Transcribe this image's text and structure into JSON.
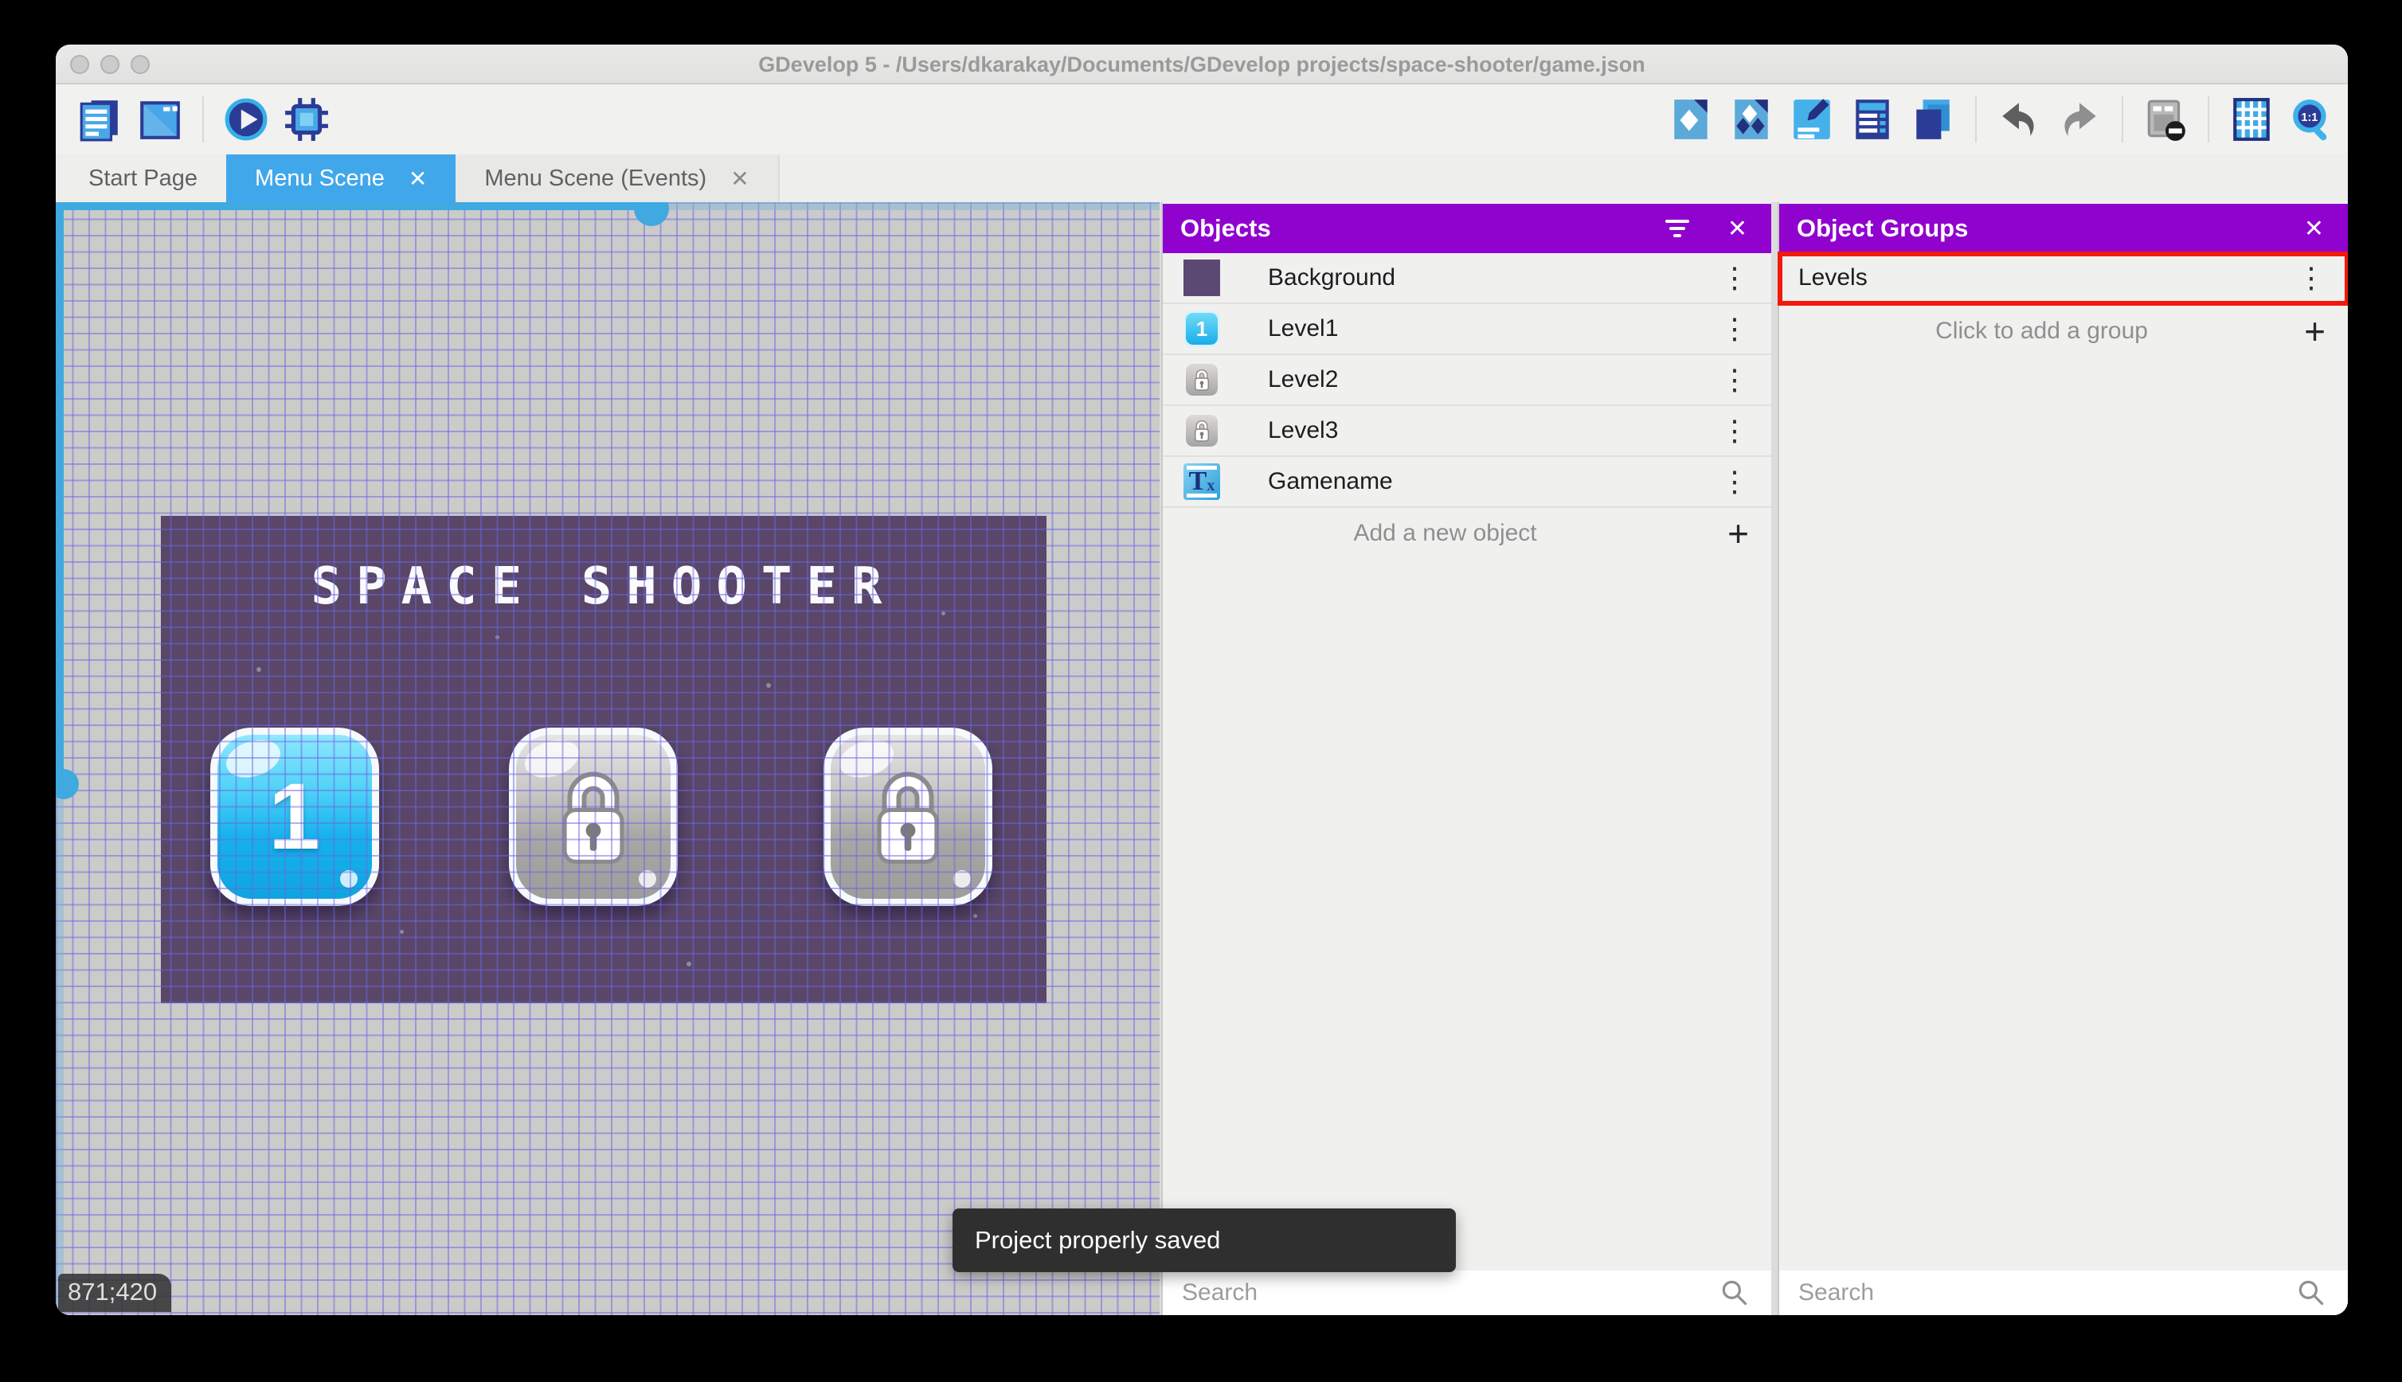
{
  "window": {
    "title": "GDevelop 5 - /Users/dkarakay/Documents/GDevelop projects/space-shooter/game.json"
  },
  "toolbar": {
    "left_icons": [
      "project-manager",
      "scene-window",
      "play-preview",
      "debug"
    ],
    "right_icons": [
      "objects-panel",
      "object-groups-panel",
      "properties",
      "instances-list",
      "layers",
      "undo",
      "redo",
      "render-mask",
      "grid",
      "zoom-1-1"
    ]
  },
  "tabs": [
    {
      "label": "Start Page",
      "active": false,
      "closable": false
    },
    {
      "label": "Menu Scene",
      "active": true,
      "closable": true,
      "close_glyph": "✕"
    },
    {
      "label": "Menu Scene (Events)",
      "active": false,
      "closable": true,
      "close_glyph": "✕"
    }
  ],
  "canvas": {
    "coordinates": "871;420",
    "scene": {
      "title": "SPACE SHOOTER",
      "buttons": [
        {
          "label": "1",
          "state": "unlocked"
        },
        {
          "label": "",
          "state": "locked"
        },
        {
          "label": "",
          "state": "locked"
        }
      ]
    }
  },
  "objects_panel": {
    "title": "Objects",
    "close_glyph": "✕",
    "items": [
      {
        "name": "Background",
        "icon": "purple-square"
      },
      {
        "name": "Level1",
        "icon": "blue-level-button",
        "icon_label": "1"
      },
      {
        "name": "Level2",
        "icon": "gray-lock-button"
      },
      {
        "name": "Level3",
        "icon": "gray-lock-button"
      },
      {
        "name": "Gamename",
        "icon": "text-object",
        "icon_t": "T",
        "icon_x": "x"
      }
    ],
    "add_label": "Add a new object",
    "add_glyph": "+",
    "search_placeholder": "Search"
  },
  "object_groups_panel": {
    "title": "Object Groups",
    "close_glyph": "✕",
    "groups": [
      {
        "name": "Levels",
        "highlighted": true
      }
    ],
    "add_label": "Click to add a group",
    "add_glyph": "+",
    "search_placeholder": "Search"
  },
  "toast": {
    "message": "Project properly saved"
  },
  "colors": {
    "panel_header_purple": "#9002ce",
    "active_tab_blue": "#41a7eb",
    "highlight_red": "#f2190a",
    "scene_background_purple": "#594669",
    "grid_line_blue": "#7b74df",
    "scrollbar_blue": "#3fa9e0",
    "toast_background": "#2f2f2f"
  },
  "kebab_glyph": "⋮"
}
